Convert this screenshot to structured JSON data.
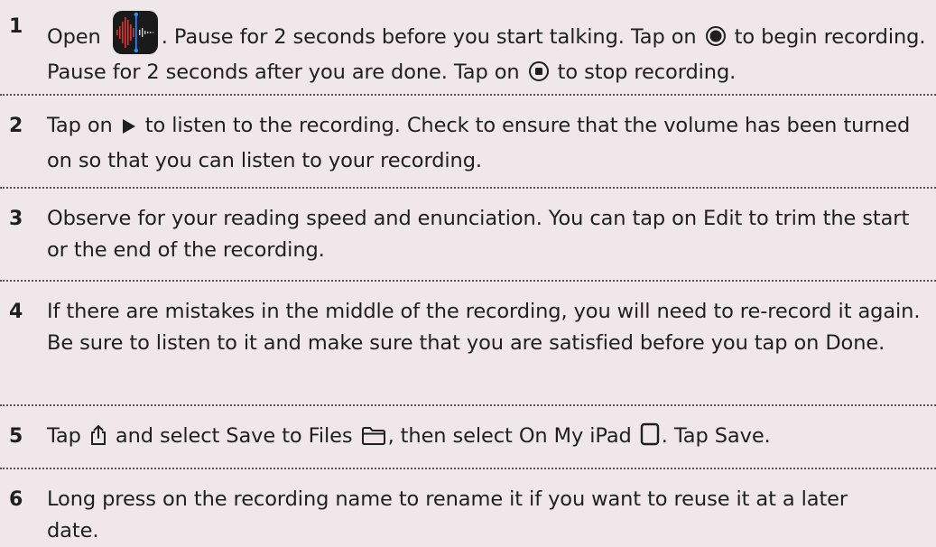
{
  "steps": [
    {
      "number": "1",
      "parts": {
        "a": "Open",
        "b": ". Pause for 2 seconds before you start talking. Tap on",
        "c": "to begin recording. Pause for 2 seconds after you are done. Tap on",
        "d": "to stop recording."
      }
    },
    {
      "number": "2",
      "parts": {
        "a": "Tap on",
        "b": "to listen to the recording. Check to ensure that the volume has been turned on so that you can listen to your recording."
      }
    },
    {
      "number": "3",
      "text": "Observe for your reading speed and enunciation. You can tap on Edit to trim the start or the end of the recording."
    },
    {
      "number": "4",
      "text": "If there are mistakes in the middle of the recording, you will need to re-record it again. Be sure to listen to it and make sure that you are satisfied before you tap on Done."
    },
    {
      "number": "5",
      "parts": {
        "a": "Tap",
        "b": "and select Save to Files",
        "c": ", then select On My iPad",
        "d": ". Tap Save."
      }
    },
    {
      "number": "6",
      "text": "Long press on the recording name to rename it if you want to reuse it at a later date."
    }
  ],
  "colors": {
    "background": "#efe7ea",
    "text": "#1f1f1f",
    "app_icon_bg": "#1a1a1a",
    "waveform": "#e0352b",
    "playhead": "#2e8ff0"
  },
  "icons": {
    "app": "voice-memos-app-icon",
    "record": "record-icon",
    "stop": "stop-icon",
    "play": "play-icon",
    "share": "share-icon",
    "folder": "folder-icon",
    "ipad": "ipad-icon"
  }
}
